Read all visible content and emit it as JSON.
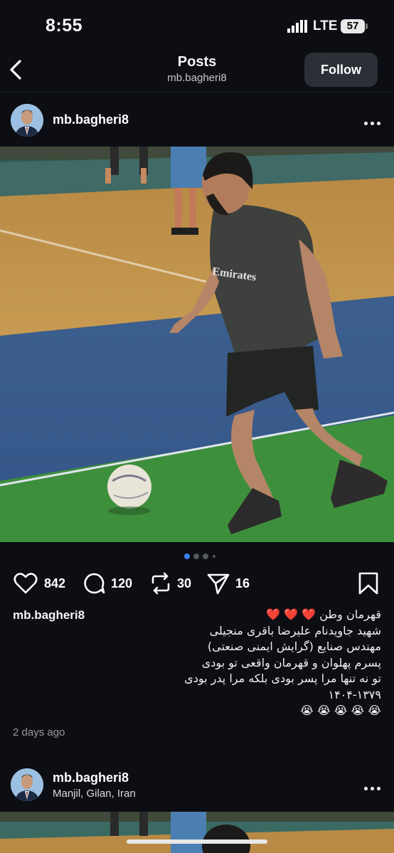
{
  "status_bar": {
    "time": "8:55",
    "network": "LTE",
    "battery": "57"
  },
  "header": {
    "title": "Posts",
    "subtitle": "mb.bagheri8",
    "follow_label": "Follow"
  },
  "post": {
    "username": "mb.bagheri8",
    "actions": {
      "likes": "842",
      "comments": "120",
      "reposts": "30",
      "shares": "16"
    },
    "caption_user": "mb.bagheri8",
    "caption_lines": [
      "قهرمان وطن ❤️ ❤️ ❤️",
      "شهید جاویدنام علیرضا باقری منجیلی",
      "مهندس صنایع (گرایش ایمنی صنعتی)",
      "پسرم پهلوان و قهرمان واقعی تو بودی",
      "تو نه تنها مرا پسر بودی بلکه مرا پدر بودی",
      "۱۴۰۴-۱۳۷۹",
      "😭 😭 😭 😭 😭"
    ],
    "time_ago": "2 days ago",
    "carousel": {
      "total": 4,
      "active": 1
    }
  },
  "next_post": {
    "username": "mb.bagheri8",
    "location": "Manjil, Gilan, Iran"
  },
  "icons": {
    "back": "chevron-left-icon",
    "like": "heart-icon",
    "comment": "comment-icon",
    "repost": "repost-icon",
    "share": "send-icon",
    "save": "bookmark-icon",
    "more": "more-icon"
  },
  "colors": {
    "background": "#0c0e13",
    "follow_button": "#2c2f36",
    "active_dot": "#3b82f6"
  }
}
